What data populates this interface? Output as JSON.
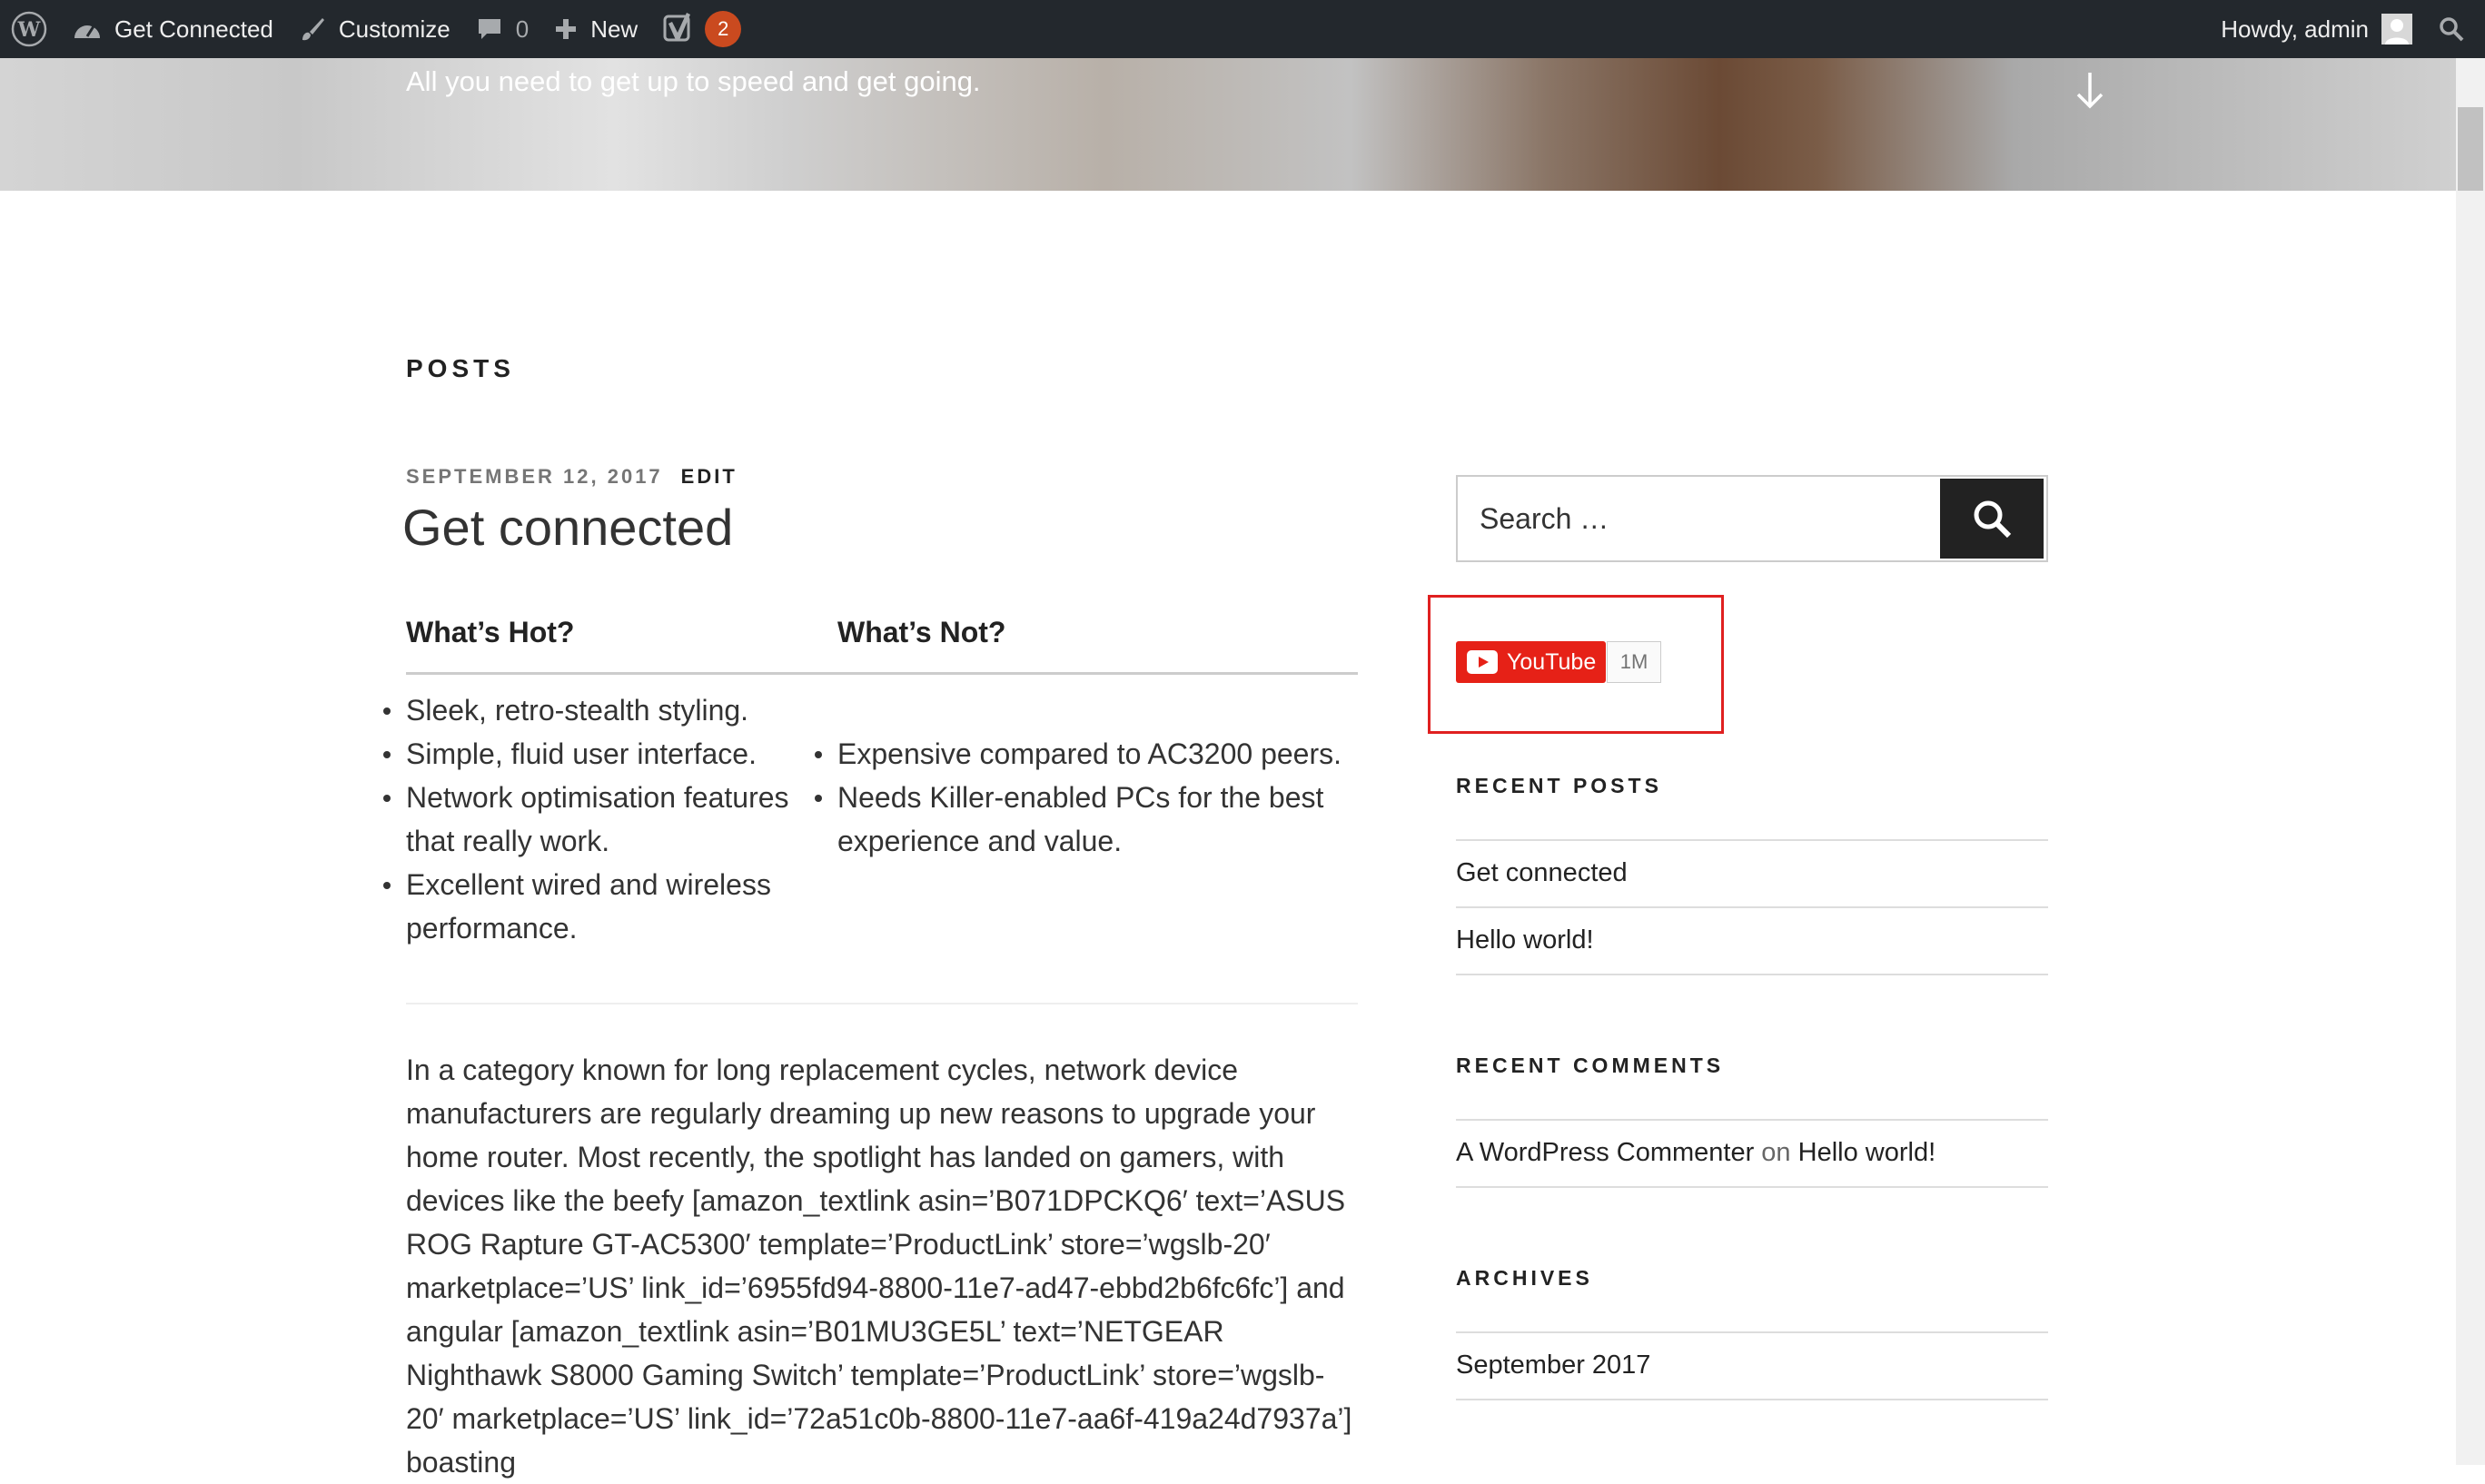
{
  "adminbar": {
    "site_name": "Get Connected",
    "customize_label": "Customize",
    "comments_count": "0",
    "new_label": "New",
    "yoast_badge": "2",
    "howdy_label": "Howdy, admin"
  },
  "hero": {
    "tagline": "All you need to get up to speed and get going."
  },
  "main": {
    "section_title": "POSTS",
    "post": {
      "date": "SEPTEMBER 12, 2017",
      "edit_label": "EDIT",
      "title": "Get connected",
      "hot_heading": "What’s Hot?",
      "not_heading": "What’s Not?",
      "hot_items": [
        "Sleek, retro-stealth styling.",
        "Simple, fluid user interface.",
        "Network optimisation features that really work.",
        "Excellent wired and wireless performance."
      ],
      "not_items": [
        "Expensive compared to AC3200 peers.",
        "Needs Killer-enabled PCs for the best experience and value."
      ],
      "body": "In a category known for long replacement cycles, network device manufacturers are regularly dreaming up new reasons to upgrade your home router. Most recently, the spotlight has landed on gamers, with devices like the beefy [amazon_textlink asin=’B071DPCKQ6′ text=’ASUS ROG Rapture GT-AC5300′ template=’ProductLink’ store=’wgslb-20′ marketplace=’US’ link_id=’6955fd94-8800-11e7-ad47-ebbd2b6fc6fc’] and angular [amazon_textlink asin=’B01MU3GE5L’ text=’NETGEAR Nighthawk S8000 Gaming Switch’ template=’ProductLink’ store=’wgslb-20′ marketplace=’US’ link_id=’72a51c0b-8800-11e7-aa6f-419a24d7937a’] boasting"
    }
  },
  "sidebar": {
    "search_placeholder": "Search …",
    "youtube_label": "YouTube",
    "youtube_count": "1M",
    "recent_posts_title": "RECENT POSTS",
    "recent_posts": [
      "Get connected",
      "Hello world!"
    ],
    "recent_comments_title": "RECENT COMMENTS",
    "comment_author": "A WordPress Commenter",
    "comment_on": "on",
    "comment_post": "Hello world!",
    "archives_title": "ARCHIVES",
    "archives": [
      "September 2017"
    ]
  },
  "colors": {
    "adminbar_bg": "#23282d",
    "youtube_red": "#e62117",
    "highlight_border": "#e02020",
    "badge_orange": "#ca4a1f"
  }
}
